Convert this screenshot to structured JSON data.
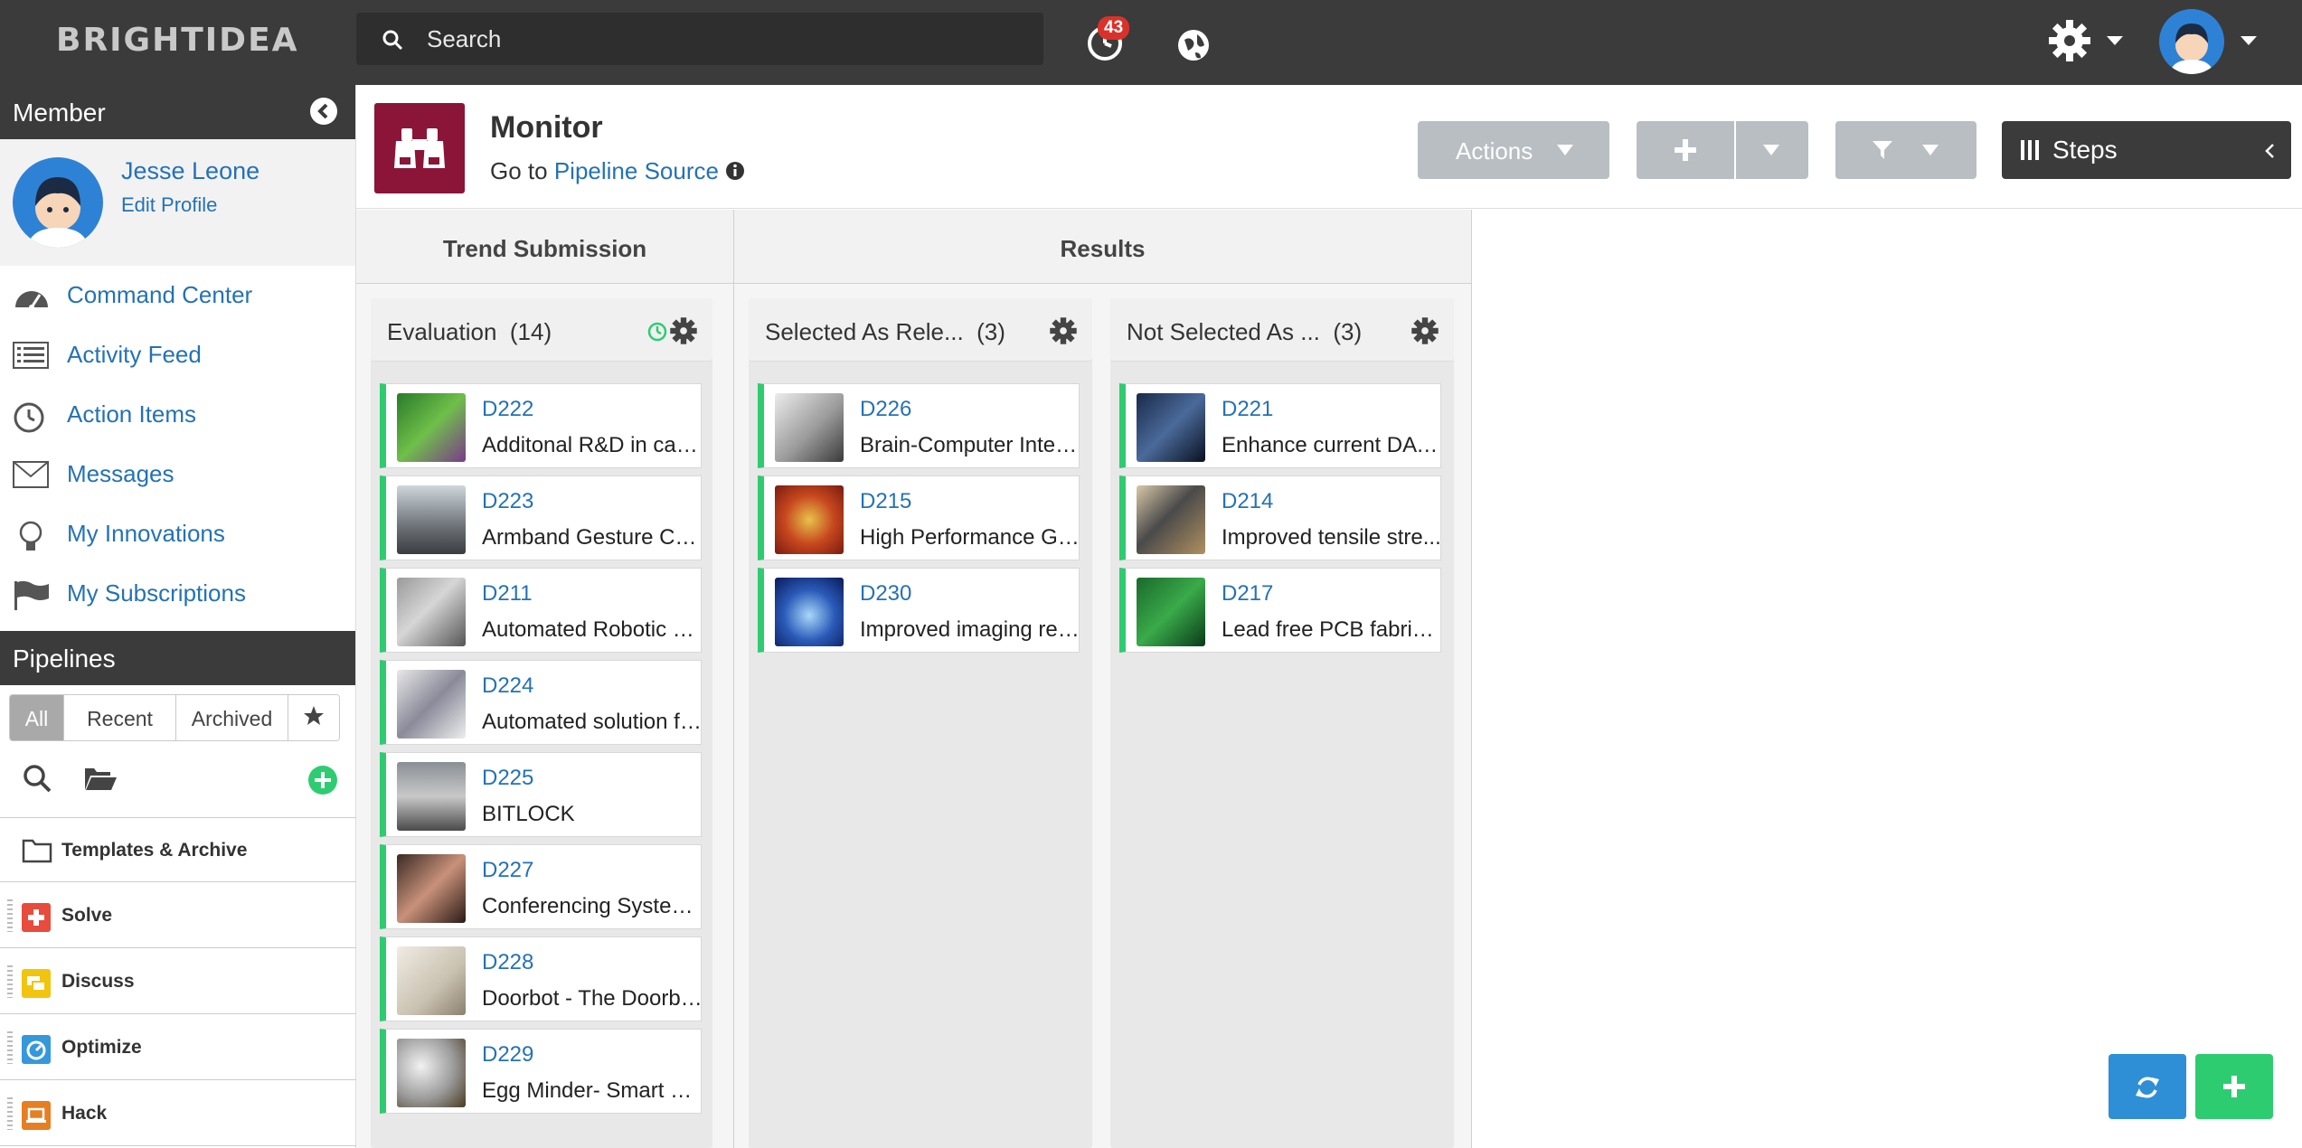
{
  "topbar": {
    "logo": "BRIGHTIDEA",
    "search_placeholder": "Search",
    "notification_count": "43"
  },
  "sidebar": {
    "member_title": "Member",
    "user_name": "Jesse Leone",
    "edit_profile": "Edit Profile",
    "nav": [
      {
        "label": "Command Center",
        "icon": "speedometer-icon"
      },
      {
        "label": "Activity Feed",
        "icon": "list-icon"
      },
      {
        "label": "Action Items",
        "icon": "clock-icon"
      },
      {
        "label": "Messages",
        "icon": "envelope-icon"
      },
      {
        "label": "My Innovations",
        "icon": "lightbulb-icon"
      },
      {
        "label": "My Subscriptions",
        "icon": "flag-icon"
      }
    ],
    "pipelines_title": "Pipelines",
    "filters": [
      "All",
      "Recent",
      "Archived"
    ],
    "templates_label": "Templates & Archive",
    "pipelines": [
      {
        "label": "Solve",
        "color": "#e74c3c"
      },
      {
        "label": "Discuss",
        "color": "#f1c40f"
      },
      {
        "label": "Optimize",
        "color": "#3498db"
      },
      {
        "label": "Hack",
        "color": "#e67e22"
      }
    ]
  },
  "header": {
    "title": "Monitor",
    "goto_prefix": "Go to",
    "goto_link": "Pipeline Source",
    "actions_label": "Actions",
    "steps_label": "Steps"
  },
  "stages": [
    "Trend Submission",
    "Results"
  ],
  "columns": [
    {
      "title": "Evaluation",
      "count": "(14)",
      "cards": [
        {
          "id": "D222",
          "title": "Additonal R&D in carb..."
        },
        {
          "id": "D223",
          "title": "Armband Gesture Con..."
        },
        {
          "id": "D211",
          "title": "Automated Robotic W..."
        },
        {
          "id": "D224",
          "title": "Automated solution fo..."
        },
        {
          "id": "D225",
          "title": "BITLOCK"
        },
        {
          "id": "D227",
          "title": "Conferencing System ..."
        },
        {
          "id": "D228",
          "title": "Doorbot - The Doorbe..."
        },
        {
          "id": "D229",
          "title": "Egg Minder- Smart Eg..."
        }
      ]
    },
    {
      "title": "Selected As Rele...",
      "count": "(3)",
      "cards": [
        {
          "id": "D226",
          "title": "Brain-Computer Interf..."
        },
        {
          "id": "D215",
          "title": "High Performance GP..."
        },
        {
          "id": "D230",
          "title": "Improved imaging res..."
        }
      ]
    },
    {
      "title": "Not Selected As ...",
      "count": "(3)",
      "cards": [
        {
          "id": "D221",
          "title": "Enhance current DAW..."
        },
        {
          "id": "D214",
          "title": "Improved tensile stre..."
        },
        {
          "id": "D217",
          "title": "Lead free PCB fabricat..."
        }
      ]
    }
  ],
  "colors": {
    "accent": "#2472b5",
    "topbar": "#3b3b3b",
    "card_status": "#2ecc71",
    "page_icon": "#8a1538",
    "refresh_button": "#2e8fd6",
    "add_button": "#2ecc71"
  }
}
